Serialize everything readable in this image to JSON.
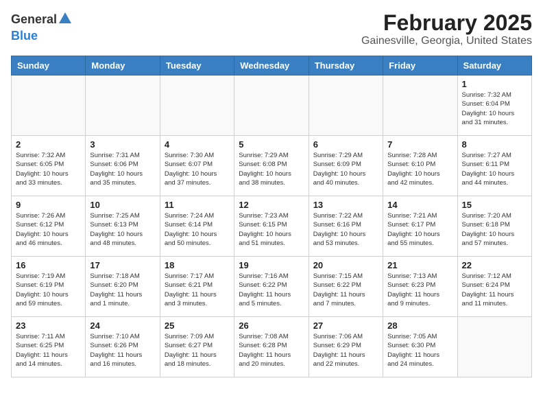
{
  "header": {
    "logo_general": "General",
    "logo_blue": "Blue",
    "title": "February 2025",
    "subtitle": "Gainesville, Georgia, United States"
  },
  "weekdays": [
    "Sunday",
    "Monday",
    "Tuesday",
    "Wednesday",
    "Thursday",
    "Friday",
    "Saturday"
  ],
  "weeks": [
    [
      {
        "day": "",
        "info": ""
      },
      {
        "day": "",
        "info": ""
      },
      {
        "day": "",
        "info": ""
      },
      {
        "day": "",
        "info": ""
      },
      {
        "day": "",
        "info": ""
      },
      {
        "day": "",
        "info": ""
      },
      {
        "day": "1",
        "info": "Sunrise: 7:32 AM\nSunset: 6:04 PM\nDaylight: 10 hours\nand 31 minutes."
      }
    ],
    [
      {
        "day": "2",
        "info": "Sunrise: 7:32 AM\nSunset: 6:05 PM\nDaylight: 10 hours\nand 33 minutes."
      },
      {
        "day": "3",
        "info": "Sunrise: 7:31 AM\nSunset: 6:06 PM\nDaylight: 10 hours\nand 35 minutes."
      },
      {
        "day": "4",
        "info": "Sunrise: 7:30 AM\nSunset: 6:07 PM\nDaylight: 10 hours\nand 37 minutes."
      },
      {
        "day": "5",
        "info": "Sunrise: 7:29 AM\nSunset: 6:08 PM\nDaylight: 10 hours\nand 38 minutes."
      },
      {
        "day": "6",
        "info": "Sunrise: 7:29 AM\nSunset: 6:09 PM\nDaylight: 10 hours\nand 40 minutes."
      },
      {
        "day": "7",
        "info": "Sunrise: 7:28 AM\nSunset: 6:10 PM\nDaylight: 10 hours\nand 42 minutes."
      },
      {
        "day": "8",
        "info": "Sunrise: 7:27 AM\nSunset: 6:11 PM\nDaylight: 10 hours\nand 44 minutes."
      }
    ],
    [
      {
        "day": "9",
        "info": "Sunrise: 7:26 AM\nSunset: 6:12 PM\nDaylight: 10 hours\nand 46 minutes."
      },
      {
        "day": "10",
        "info": "Sunrise: 7:25 AM\nSunset: 6:13 PM\nDaylight: 10 hours\nand 48 minutes."
      },
      {
        "day": "11",
        "info": "Sunrise: 7:24 AM\nSunset: 6:14 PM\nDaylight: 10 hours\nand 50 minutes."
      },
      {
        "day": "12",
        "info": "Sunrise: 7:23 AM\nSunset: 6:15 PM\nDaylight: 10 hours\nand 51 minutes."
      },
      {
        "day": "13",
        "info": "Sunrise: 7:22 AM\nSunset: 6:16 PM\nDaylight: 10 hours\nand 53 minutes."
      },
      {
        "day": "14",
        "info": "Sunrise: 7:21 AM\nSunset: 6:17 PM\nDaylight: 10 hours\nand 55 minutes."
      },
      {
        "day": "15",
        "info": "Sunrise: 7:20 AM\nSunset: 6:18 PM\nDaylight: 10 hours\nand 57 minutes."
      }
    ],
    [
      {
        "day": "16",
        "info": "Sunrise: 7:19 AM\nSunset: 6:19 PM\nDaylight: 10 hours\nand 59 minutes."
      },
      {
        "day": "17",
        "info": "Sunrise: 7:18 AM\nSunset: 6:20 PM\nDaylight: 11 hours\nand 1 minute."
      },
      {
        "day": "18",
        "info": "Sunrise: 7:17 AM\nSunset: 6:21 PM\nDaylight: 11 hours\nand 3 minutes."
      },
      {
        "day": "19",
        "info": "Sunrise: 7:16 AM\nSunset: 6:22 PM\nDaylight: 11 hours\nand 5 minutes."
      },
      {
        "day": "20",
        "info": "Sunrise: 7:15 AM\nSunset: 6:22 PM\nDaylight: 11 hours\nand 7 minutes."
      },
      {
        "day": "21",
        "info": "Sunrise: 7:13 AM\nSunset: 6:23 PM\nDaylight: 11 hours\nand 9 minutes."
      },
      {
        "day": "22",
        "info": "Sunrise: 7:12 AM\nSunset: 6:24 PM\nDaylight: 11 hours\nand 11 minutes."
      }
    ],
    [
      {
        "day": "23",
        "info": "Sunrise: 7:11 AM\nSunset: 6:25 PM\nDaylight: 11 hours\nand 14 minutes."
      },
      {
        "day": "24",
        "info": "Sunrise: 7:10 AM\nSunset: 6:26 PM\nDaylight: 11 hours\nand 16 minutes."
      },
      {
        "day": "25",
        "info": "Sunrise: 7:09 AM\nSunset: 6:27 PM\nDaylight: 11 hours\nand 18 minutes."
      },
      {
        "day": "26",
        "info": "Sunrise: 7:08 AM\nSunset: 6:28 PM\nDaylight: 11 hours\nand 20 minutes."
      },
      {
        "day": "27",
        "info": "Sunrise: 7:06 AM\nSunset: 6:29 PM\nDaylight: 11 hours\nand 22 minutes."
      },
      {
        "day": "28",
        "info": "Sunrise: 7:05 AM\nSunset: 6:30 PM\nDaylight: 11 hours\nand 24 minutes."
      },
      {
        "day": "",
        "info": ""
      }
    ]
  ]
}
